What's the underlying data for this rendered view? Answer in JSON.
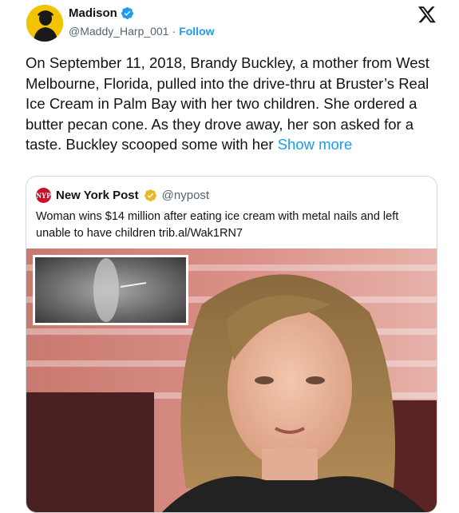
{
  "author": {
    "name": "Madison",
    "handle": "@Maddy_Harp_001",
    "separator": "·",
    "follow_label": "Follow",
    "avatar_icon": "silhouette-portrait-yellow",
    "verified_icon": "blue-verified-badge"
  },
  "tweet": {
    "text": "On September 11, 2018, Brandy Buckley, a mother from West Melbourne, Florida, pulled into the drive-thru at Bruster’s Real Ice Cream in Palm Bay with her two children. She ordered a butter pecan cone. As they drove away, her son asked for a taste. Buckley scooped some with her ",
    "show_more_label": "Show more"
  },
  "quoted": {
    "name": "New York Post",
    "handle": "@nypost",
    "logo_text": "NY POST",
    "badge_icon": "gold-verified-badge",
    "text": "Woman wins $14 million after eating ice cream with metal nails and left unable to have children trib.al/Wak1RN7"
  },
  "colors": {
    "accent": "#1d9bf0",
    "gold": "#e8b829",
    "nyp_red": "#c8102e"
  },
  "icons": {
    "x_logo": "x-logo-icon"
  }
}
